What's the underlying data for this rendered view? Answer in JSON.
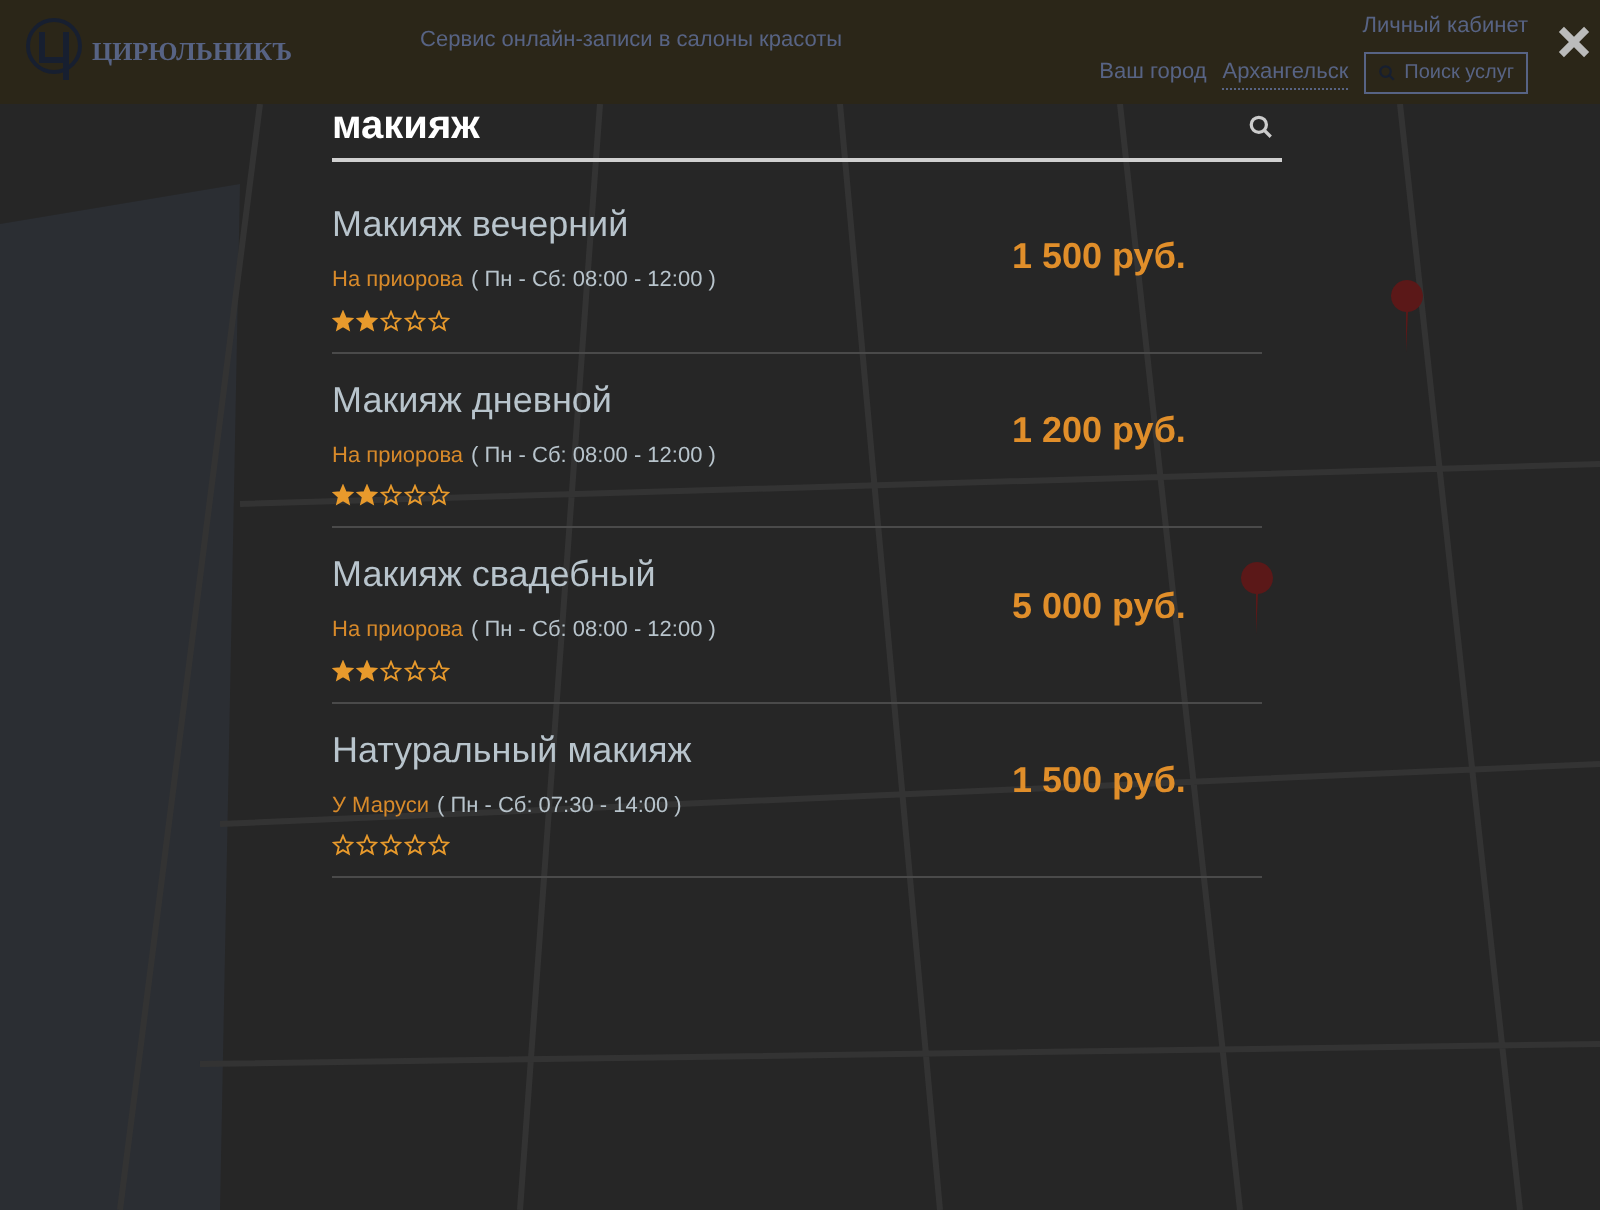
{
  "header": {
    "logo_text": "ЦИРЮЛЬНИКЪ",
    "tagline": "Сервис онлайн-записи в салоны красоты",
    "account_link": "Личный кабинет",
    "city_label": "Ваш город",
    "city": "Архангельск",
    "search_button": "Поиск услуг"
  },
  "search": {
    "value": "макияж"
  },
  "results": [
    {
      "title": "Макияж вечерний",
      "salon": "На приорова",
      "hours": "( Пн - Сб: 08:00 - 12:00 )",
      "stars": 2,
      "price": "1 500 руб."
    },
    {
      "title": "Макияж дневной",
      "salon": "На приорова",
      "hours": "( Пн - Сб: 08:00 - 12:00 )",
      "stars": 2,
      "price": "1 200 руб."
    },
    {
      "title": "Макияж свадебный",
      "salon": "На приорова",
      "hours": "( Пн - Сб: 08:00 - 12:00 )",
      "stars": 2,
      "price": "5 000 руб."
    },
    {
      "title": "Натуральный макияж",
      "salon": "У Маруси",
      "hours": "( Пн - Сб: 07:30 - 14:00 )",
      "stars": 0,
      "price": "1 500 руб."
    }
  ]
}
